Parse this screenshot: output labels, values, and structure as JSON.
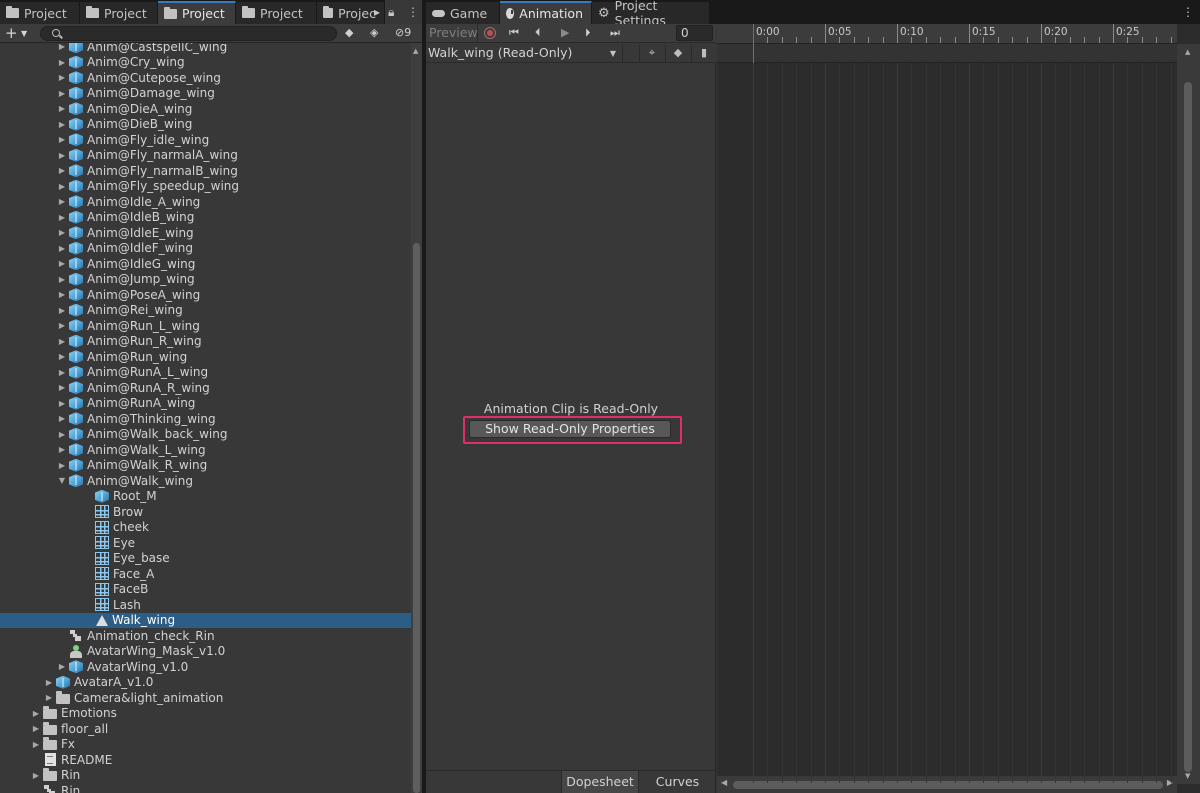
{
  "project_tabs": [
    {
      "label": "Project"
    },
    {
      "label": "Project"
    },
    {
      "label": "Project"
    },
    {
      "label": "Project"
    },
    {
      "label": "Projec"
    }
  ],
  "project_toolbar": {
    "search_placeholder": "",
    "hidden_count": "9"
  },
  "tree": [
    {
      "label": "Anim@CastspellC_wing",
      "icon": "cube-icon",
      "indent": 1,
      "arrow": "collapsed"
    },
    {
      "label": "Anim@Cry_wing",
      "icon": "cube-icon",
      "indent": 1,
      "arrow": "collapsed"
    },
    {
      "label": "Anim@Cutepose_wing",
      "icon": "cube-icon",
      "indent": 1,
      "arrow": "collapsed"
    },
    {
      "label": "Anim@Damage_wing",
      "icon": "cube-icon",
      "indent": 1,
      "arrow": "collapsed"
    },
    {
      "label": "Anim@DieA_wing",
      "icon": "cube-icon",
      "indent": 1,
      "arrow": "collapsed"
    },
    {
      "label": "Anim@DieB_wing",
      "icon": "cube-icon",
      "indent": 1,
      "arrow": "collapsed"
    },
    {
      "label": "Anim@Fly_idle_wing",
      "icon": "cube-icon",
      "indent": 1,
      "arrow": "collapsed"
    },
    {
      "label": "Anim@Fly_narmalA_wing",
      "icon": "cube-icon",
      "indent": 1,
      "arrow": "collapsed"
    },
    {
      "label": "Anim@Fly_narmalB_wing",
      "icon": "cube-icon",
      "indent": 1,
      "arrow": "collapsed"
    },
    {
      "label": "Anim@Fly_speedup_wing",
      "icon": "cube-icon",
      "indent": 1,
      "arrow": "collapsed"
    },
    {
      "label": "Anim@Idle_A_wing",
      "icon": "cube-icon",
      "indent": 1,
      "arrow": "collapsed"
    },
    {
      "label": "Anim@IdleB_wing",
      "icon": "cube-icon",
      "indent": 1,
      "arrow": "collapsed"
    },
    {
      "label": "Anim@IdleE_wing",
      "icon": "cube-icon",
      "indent": 1,
      "arrow": "collapsed"
    },
    {
      "label": "Anim@IdleF_wing",
      "icon": "cube-icon",
      "indent": 1,
      "arrow": "collapsed"
    },
    {
      "label": "Anim@IdleG_wing",
      "icon": "cube-icon",
      "indent": 1,
      "arrow": "collapsed"
    },
    {
      "label": "Anim@Jump_wing",
      "icon": "cube-icon",
      "indent": 1,
      "arrow": "collapsed"
    },
    {
      "label": "Anim@PoseA_wing",
      "icon": "cube-icon",
      "indent": 1,
      "arrow": "collapsed"
    },
    {
      "label": "Anim@Rei_wing",
      "icon": "cube-icon",
      "indent": 1,
      "arrow": "collapsed"
    },
    {
      "label": "Anim@Run_L_wing",
      "icon": "cube-icon",
      "indent": 1,
      "arrow": "collapsed"
    },
    {
      "label": "Anim@Run_R_wing",
      "icon": "cube-icon",
      "indent": 1,
      "arrow": "collapsed"
    },
    {
      "label": "Anim@Run_wing",
      "icon": "cube-icon",
      "indent": 1,
      "arrow": "collapsed"
    },
    {
      "label": "Anim@RunA_L_wing",
      "icon": "cube-icon",
      "indent": 1,
      "arrow": "collapsed"
    },
    {
      "label": "Anim@RunA_R_wing",
      "icon": "cube-icon",
      "indent": 1,
      "arrow": "collapsed"
    },
    {
      "label": "Anim@RunA_wing",
      "icon": "cube-icon",
      "indent": 1,
      "arrow": "collapsed"
    },
    {
      "label": "Anim@Thinking_wing",
      "icon": "cube-icon",
      "indent": 1,
      "arrow": "collapsed"
    },
    {
      "label": "Anim@Walk_back_wing",
      "icon": "cube-icon",
      "indent": 1,
      "arrow": "collapsed"
    },
    {
      "label": "Anim@Walk_L_wing",
      "icon": "cube-icon",
      "indent": 1,
      "arrow": "collapsed"
    },
    {
      "label": "Anim@Walk_R_wing",
      "icon": "cube-icon",
      "indent": 1,
      "arrow": "collapsed"
    },
    {
      "label": "Anim@Walk_wing",
      "icon": "cube-icon",
      "indent": 1,
      "arrow": "expanded"
    },
    {
      "label": "Root_M",
      "icon": "cube-icon",
      "indent": 2,
      "arrow": "none"
    },
    {
      "label": "Brow",
      "icon": "mesh-grid-icon",
      "indent": 2,
      "arrow": "none"
    },
    {
      "label": "cheek",
      "icon": "mesh-grid-icon",
      "indent": 2,
      "arrow": "none"
    },
    {
      "label": "Eye",
      "icon": "mesh-grid-icon",
      "indent": 2,
      "arrow": "none"
    },
    {
      "label": "Eye_base",
      "icon": "mesh-grid-icon",
      "indent": 2,
      "arrow": "none"
    },
    {
      "label": "Face_A",
      "icon": "mesh-grid-icon",
      "indent": 2,
      "arrow": "none"
    },
    {
      "label": "FaceB",
      "icon": "mesh-grid-icon",
      "indent": 2,
      "arrow": "none"
    },
    {
      "label": "Lash",
      "icon": "mesh-grid-icon",
      "indent": 2,
      "arrow": "none"
    },
    {
      "label": "Walk_wing",
      "icon": "animation-clip-icon",
      "indent": 2,
      "arrow": "none",
      "selected": true
    },
    {
      "label": "Animation_check_Rin",
      "icon": "animator-controller-icon",
      "indent": 1,
      "arrow": "none"
    },
    {
      "label": "AvatarWing_Mask_v1.0",
      "icon": "avatar-mask-icon",
      "indent": 1,
      "arrow": "none"
    },
    {
      "label": "AvatarWing_v1.0",
      "icon": "cube-icon",
      "indent": 1,
      "arrow": "collapsed"
    },
    {
      "label": "AvatarA_v1.0",
      "icon": "cube-icon",
      "indent": 0.5,
      "arrow": "collapsed"
    },
    {
      "label": "Camera&light_animation",
      "icon": "folder-icon",
      "indent": 0.5,
      "arrow": "collapsed"
    },
    {
      "label": "Emotions",
      "icon": "folder-icon",
      "indent": 0,
      "arrow": "collapsed"
    },
    {
      "label": "floor_all",
      "icon": "folder-icon",
      "indent": 0,
      "arrow": "collapsed"
    },
    {
      "label": "Fx",
      "icon": "folder-icon",
      "indent": 0,
      "arrow": "collapsed"
    },
    {
      "label": "README",
      "icon": "document-icon",
      "indent": 0,
      "arrow": "none"
    },
    {
      "label": "Rin",
      "icon": "folder-icon",
      "indent": 0,
      "arrow": "collapsed"
    },
    {
      "label": "Rin",
      "icon": "animator-controller-icon",
      "indent": 0,
      "arrow": "none"
    }
  ],
  "anim_tabs": {
    "game": "Game",
    "animation": "Animation",
    "project_settings": "Project Settings"
  },
  "anim_controls": {
    "preview": "Preview",
    "frame": "0"
  },
  "clip": {
    "name": "Walk_wing (Read-Only)"
  },
  "readonly": {
    "message": "Animation Clip is Read-Only",
    "button": "Show Read-Only Properties"
  },
  "bottom_tabs": {
    "dopesheet": "Dopesheet",
    "curves": "Curves"
  },
  "timeline": {
    "labels": [
      "0:00",
      "0:05",
      "0:10",
      "0:15",
      "0:20",
      "0:25"
    ]
  },
  "colors": {
    "selection": "#2c5d87",
    "highlight": "#e02d6e",
    "tab_accent": "#3a79bb"
  }
}
